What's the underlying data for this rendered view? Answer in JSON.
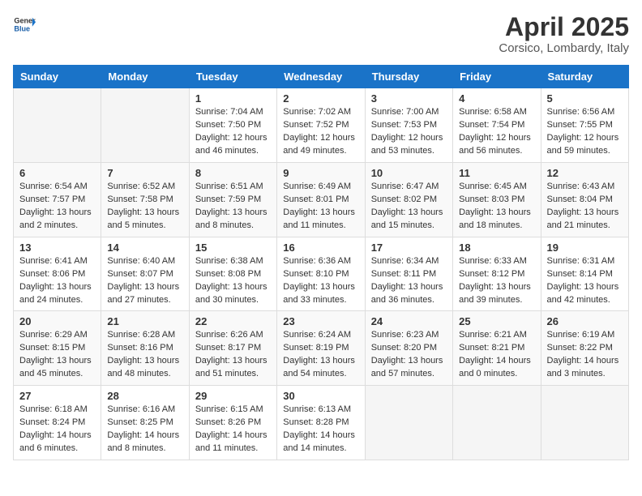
{
  "header": {
    "logo_general": "General",
    "logo_blue": "Blue",
    "month_title": "April 2025",
    "location": "Corsico, Lombardy, Italy"
  },
  "weekdays": [
    "Sunday",
    "Monday",
    "Tuesday",
    "Wednesday",
    "Thursday",
    "Friday",
    "Saturday"
  ],
  "weeks": [
    [
      null,
      null,
      {
        "day": "1",
        "sunrise": "7:04 AM",
        "sunset": "7:50 PM",
        "daylight": "12 hours and 46 minutes."
      },
      {
        "day": "2",
        "sunrise": "7:02 AM",
        "sunset": "7:52 PM",
        "daylight": "12 hours and 49 minutes."
      },
      {
        "day": "3",
        "sunrise": "7:00 AM",
        "sunset": "7:53 PM",
        "daylight": "12 hours and 53 minutes."
      },
      {
        "day": "4",
        "sunrise": "6:58 AM",
        "sunset": "7:54 PM",
        "daylight": "12 hours and 56 minutes."
      },
      {
        "day": "5",
        "sunrise": "6:56 AM",
        "sunset": "7:55 PM",
        "daylight": "12 hours and 59 minutes."
      }
    ],
    [
      {
        "day": "6",
        "sunrise": "6:54 AM",
        "sunset": "7:57 PM",
        "daylight": "13 hours and 2 minutes."
      },
      {
        "day": "7",
        "sunrise": "6:52 AM",
        "sunset": "7:58 PM",
        "daylight": "13 hours and 5 minutes."
      },
      {
        "day": "8",
        "sunrise": "6:51 AM",
        "sunset": "7:59 PM",
        "daylight": "13 hours and 8 minutes."
      },
      {
        "day": "9",
        "sunrise": "6:49 AM",
        "sunset": "8:01 PM",
        "daylight": "13 hours and 11 minutes."
      },
      {
        "day": "10",
        "sunrise": "6:47 AM",
        "sunset": "8:02 PM",
        "daylight": "13 hours and 15 minutes."
      },
      {
        "day": "11",
        "sunrise": "6:45 AM",
        "sunset": "8:03 PM",
        "daylight": "13 hours and 18 minutes."
      },
      {
        "day": "12",
        "sunrise": "6:43 AM",
        "sunset": "8:04 PM",
        "daylight": "13 hours and 21 minutes."
      }
    ],
    [
      {
        "day": "13",
        "sunrise": "6:41 AM",
        "sunset": "8:06 PM",
        "daylight": "13 hours and 24 minutes."
      },
      {
        "day": "14",
        "sunrise": "6:40 AM",
        "sunset": "8:07 PM",
        "daylight": "13 hours and 27 minutes."
      },
      {
        "day": "15",
        "sunrise": "6:38 AM",
        "sunset": "8:08 PM",
        "daylight": "13 hours and 30 minutes."
      },
      {
        "day": "16",
        "sunrise": "6:36 AM",
        "sunset": "8:10 PM",
        "daylight": "13 hours and 33 minutes."
      },
      {
        "day": "17",
        "sunrise": "6:34 AM",
        "sunset": "8:11 PM",
        "daylight": "13 hours and 36 minutes."
      },
      {
        "day": "18",
        "sunrise": "6:33 AM",
        "sunset": "8:12 PM",
        "daylight": "13 hours and 39 minutes."
      },
      {
        "day": "19",
        "sunrise": "6:31 AM",
        "sunset": "8:14 PM",
        "daylight": "13 hours and 42 minutes."
      }
    ],
    [
      {
        "day": "20",
        "sunrise": "6:29 AM",
        "sunset": "8:15 PM",
        "daylight": "13 hours and 45 minutes."
      },
      {
        "day": "21",
        "sunrise": "6:28 AM",
        "sunset": "8:16 PM",
        "daylight": "13 hours and 48 minutes."
      },
      {
        "day": "22",
        "sunrise": "6:26 AM",
        "sunset": "8:17 PM",
        "daylight": "13 hours and 51 minutes."
      },
      {
        "day": "23",
        "sunrise": "6:24 AM",
        "sunset": "8:19 PM",
        "daylight": "13 hours and 54 minutes."
      },
      {
        "day": "24",
        "sunrise": "6:23 AM",
        "sunset": "8:20 PM",
        "daylight": "13 hours and 57 minutes."
      },
      {
        "day": "25",
        "sunrise": "6:21 AM",
        "sunset": "8:21 PM",
        "daylight": "14 hours and 0 minutes."
      },
      {
        "day": "26",
        "sunrise": "6:19 AM",
        "sunset": "8:22 PM",
        "daylight": "14 hours and 3 minutes."
      }
    ],
    [
      {
        "day": "27",
        "sunrise": "6:18 AM",
        "sunset": "8:24 PM",
        "daylight": "14 hours and 6 minutes."
      },
      {
        "day": "28",
        "sunrise": "6:16 AM",
        "sunset": "8:25 PM",
        "daylight": "14 hours and 8 minutes."
      },
      {
        "day": "29",
        "sunrise": "6:15 AM",
        "sunset": "8:26 PM",
        "daylight": "14 hours and 11 minutes."
      },
      {
        "day": "30",
        "sunrise": "6:13 AM",
        "sunset": "8:28 PM",
        "daylight": "14 hours and 14 minutes."
      },
      null,
      null,
      null
    ]
  ],
  "labels": {
    "sunrise": "Sunrise: ",
    "sunset": "Sunset: ",
    "daylight": "Daylight: "
  }
}
